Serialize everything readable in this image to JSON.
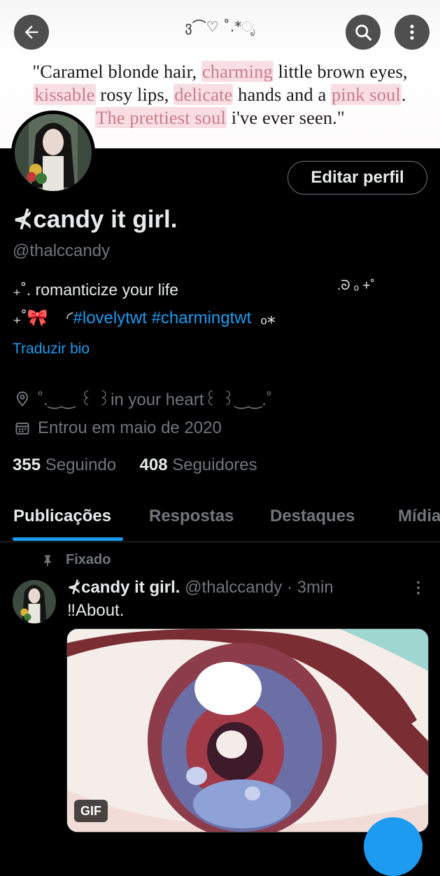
{
  "banner": {
    "deco": "ვ⌒♡ ˚.*ೃ",
    "quote": {
      "l1_a": "\"Caramel blonde hair, ",
      "l1_hl": "charming",
      "l1_b": " little brown eyes,",
      "l2_hl1": "kissable",
      "l2_a": " rosy lips, ",
      "l2_hl2": "delicate",
      "l2_b": " hands and a ",
      "l2_hl3": "pink soul",
      "l2_c": ".",
      "l3_hl": "The prettiest soul",
      "l3_a": " i've ever seen.\""
    }
  },
  "header_icons": {
    "back": "arrow-left-icon",
    "search": "search-icon",
    "more": "more-vertical-icon"
  },
  "profile": {
    "edit_button": "Editar perfil",
    "name": "⊀candy it girl.",
    "handle": "@thalccandy",
    "bio_line1": "₊˚. romanticize your life",
    "bio_line1_deco": ".ᘐ ₒ +˚",
    "bio_line2_prefix": "₊˚🎀    ◜",
    "bio_tag1": "#lovelytwt",
    "bio_tag2": "#charmingtwt",
    "bio_line2_suffix": "  ₒ⁎",
    "translate": "Traduzir bio",
    "location": "˚.‿‿ ꒰ ꒱in your heart꒰ ꒱‿‿.˚",
    "joined": "Entrou em maio de 2020",
    "following_count": "355",
    "following_label": "Seguindo",
    "followers_count": "408",
    "followers_label": "Seguidores"
  },
  "tabs": [
    {
      "label": "Publicações",
      "active": true
    },
    {
      "label": "Respostas",
      "active": false
    },
    {
      "label": "Destaques",
      "active": false
    },
    {
      "label": "Mídia",
      "active": false
    }
  ],
  "tweet": {
    "pinned_label": "Fixado",
    "name": "⊀candy it girl.",
    "handle": "@thalccandy",
    "time": "· 3min",
    "text": "‼About.",
    "gif_badge": "GIF"
  },
  "colors": {
    "accent": "#1d9bf0",
    "background": "#000000",
    "muted": "#71767b"
  }
}
